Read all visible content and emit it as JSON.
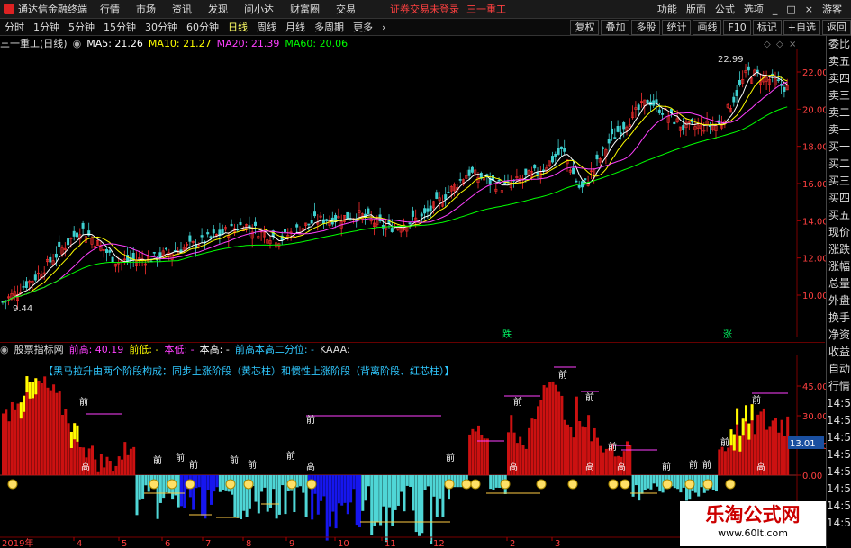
{
  "menubar": {
    "app_title": "通达信金融终端",
    "items": [
      "行情",
      "市场",
      "资讯",
      "发现",
      "问小达",
      "财富圈",
      "交易"
    ],
    "notice": "证券交易未登录",
    "stock": "三一重工",
    "right_items": [
      "功能",
      "版面",
      "公式",
      "选项",
      "游客"
    ]
  },
  "toolbar": {
    "periods": [
      "分时",
      "1分钟",
      "5分钟",
      "15分钟",
      "30分钟",
      "60分钟",
      "日线",
      "周线",
      "月线",
      "多周期",
      "更多"
    ],
    "active": "日线",
    "right_buttons": [
      "复权",
      "叠加",
      "多股",
      "统计",
      "画线",
      "F10",
      "标记",
      "+自选",
      "返回"
    ]
  },
  "main_chart": {
    "title": "三一重工(日线)",
    "ma5": "MA5: 21.26",
    "ma10": "MA10: 21.27",
    "ma20": "MA20: 21.39",
    "ma60": "MA60: 20.06",
    "high_label": "22.99",
    "low_label": "9.44",
    "y_ticks": [
      "22.00",
      "20.00",
      "18.00",
      "16.00",
      "14.00",
      "12.00",
      "10.00"
    ],
    "signals": [
      "跌",
      "涨"
    ]
  },
  "indicator": {
    "source": "股票指标网",
    "f1": "前高: 40.19",
    "f2": "前低: -",
    "f3": "本低: -",
    "f4": "本高: -",
    "f5": "前高本高二分位: -",
    "f6": "KAAA:",
    "description": "【黑马拉升由两个阶段构成：同步上涨阶段（黄芯柱）和惯性上涨阶段（背离阶段、红芯柱）】",
    "y_ticks": [
      "45.00",
      "30.00",
      "15.00",
      "0.00"
    ],
    "current_value": "13.01",
    "label_front": "前",
    "label_high": "高",
    "label_low": "低"
  },
  "x_axis": {
    "year": "2019年",
    "months": [
      "4",
      "5",
      "6",
      "7",
      "8",
      "9",
      "10",
      "11",
      "12",
      "2",
      "3"
    ]
  },
  "right_panel": {
    "items": [
      "委比",
      "卖五",
      "卖四",
      "卖三",
      "卖二",
      "卖一",
      "买一",
      "买二",
      "买三",
      "买四",
      "买五",
      "现价",
      "涨跌",
      "涨幅",
      "总量",
      "外盘",
      "换手",
      "净资",
      "收益",
      "自动",
      "行情",
      "14:50",
      "14:50",
      "14:50",
      "14:50",
      "14:50",
      "14:50",
      "14:50",
      "14:50"
    ]
  },
  "watermark": {
    "line1": "乐淘公式网",
    "line2": "www.60lt.com"
  },
  "colors": {
    "ma5": "#ffffff",
    "ma10": "#ffff00",
    "ma20": "#ff40ff",
    "ma60": "#00ff00",
    "up_bar": "#cc1111",
    "down_bar": "#4fd6d6",
    "deep_down": "#1616ee",
    "yellow_bar": "#ffff00"
  }
}
